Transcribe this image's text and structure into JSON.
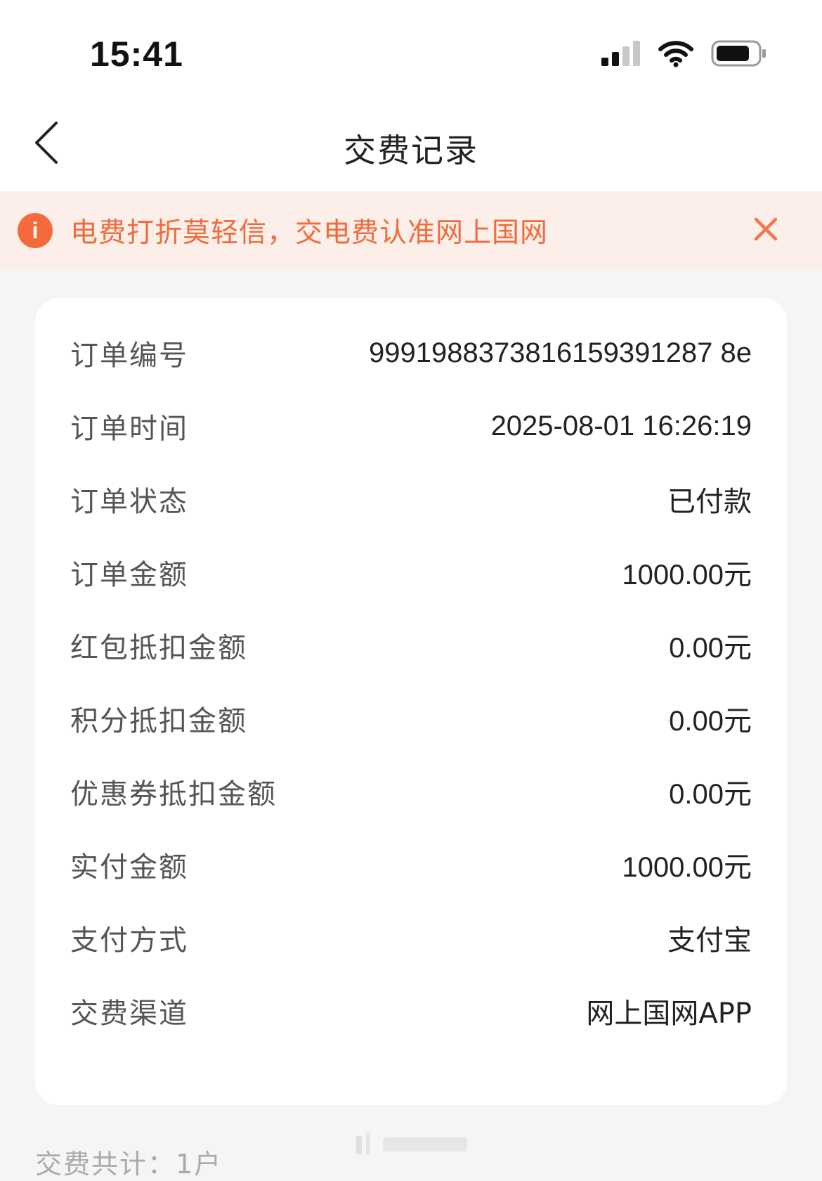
{
  "status_bar": {
    "time": "15:41"
  },
  "nav": {
    "title": "交费记录",
    "back_icon": "chevron-left-icon"
  },
  "notice": {
    "icon": "info-icon",
    "text": "电费打折莫轻信，交电费认准网上国网",
    "close_icon": "close-icon",
    "color": "#f26a3b"
  },
  "order": {
    "rows": [
      {
        "label": "订单编号",
        "value": "9991988373816159391287 8e"
      },
      {
        "label": "订单时间",
        "value": "2025-08-01 16:26:19"
      },
      {
        "label": "订单状态",
        "value": "已付款"
      },
      {
        "label": "订单金额",
        "value": "1000.00元"
      },
      {
        "label": "红包抵扣金额",
        "value": "0.00元"
      },
      {
        "label": "积分抵扣金额",
        "value": "0.00元"
      },
      {
        "label": "优惠券抵扣金额",
        "value": "0.00元"
      },
      {
        "label": "实付金额",
        "value": "1000.00元"
      },
      {
        "label": "支付方式",
        "value": "支付宝"
      },
      {
        "label": "交费渠道",
        "value": "网上国网APP"
      }
    ]
  },
  "footer": {
    "summary": "交费共计：1户"
  }
}
